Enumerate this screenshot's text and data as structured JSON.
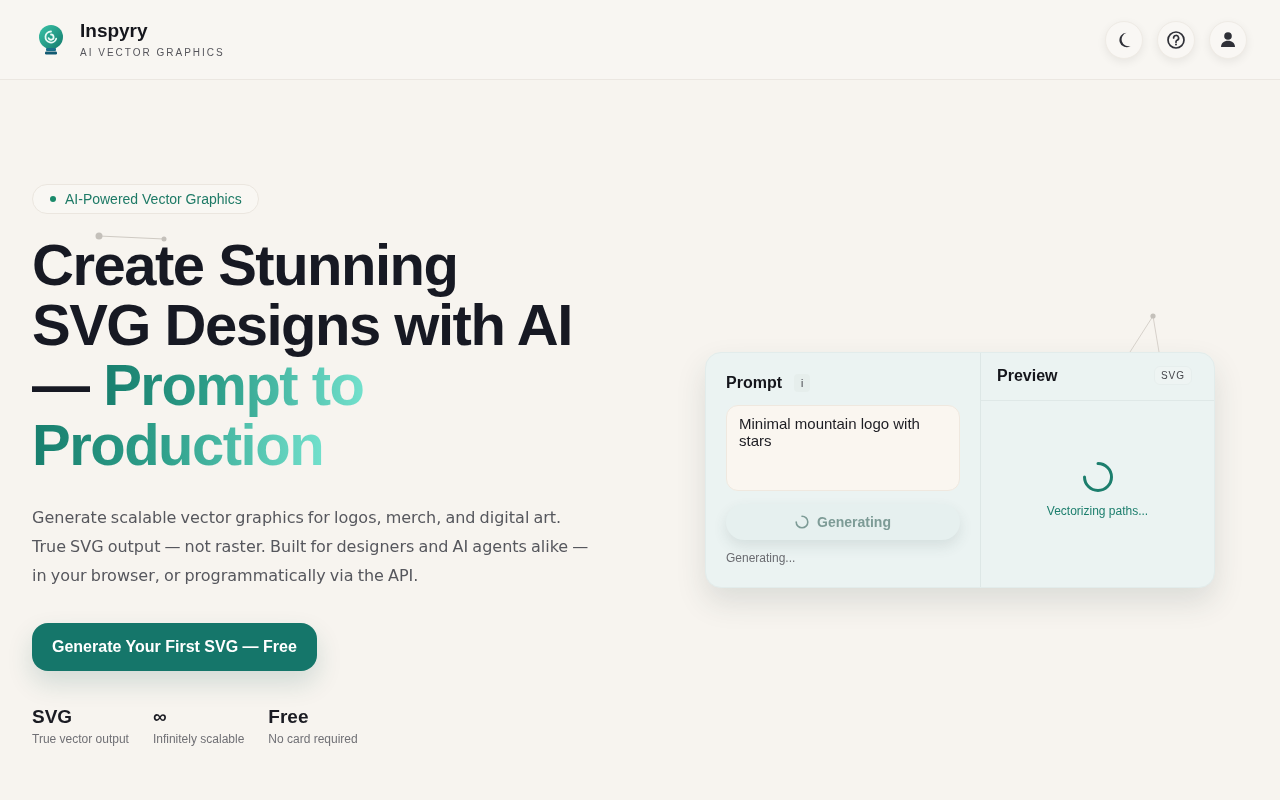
{
  "header": {
    "brand": "Inspyry",
    "tagline": "AI VECTOR GRAPHICS"
  },
  "hero": {
    "badge": "AI-Powered Vector Graphics",
    "heading": {
      "text": "Create Stunning SVG Designs with AI —",
      "accent": "Prompt to Production"
    },
    "description": "Generate scalable vector graphics for logos, merch, and digital art. True SVG output — not raster. Built for designers and AI agents alike — in your browser, or programmatically via the API.",
    "cta": "Generate Your First SVG — Free",
    "stats": [
      {
        "value": "SVG",
        "label": "True vector output"
      },
      {
        "value": "∞",
        "label": "Infinitely scalable"
      },
      {
        "value": "Free",
        "label": "No card required"
      }
    ]
  },
  "generator": {
    "prompt": {
      "title": "Prompt",
      "info": "i",
      "value": "Minimal mountain logo with stars",
      "button": {
        "label": "Generating",
        "disabled": true
      },
      "status": "Generating..."
    },
    "preview": {
      "title": "Preview",
      "format": "SVG",
      "status": "Vectorizing paths..."
    }
  }
}
